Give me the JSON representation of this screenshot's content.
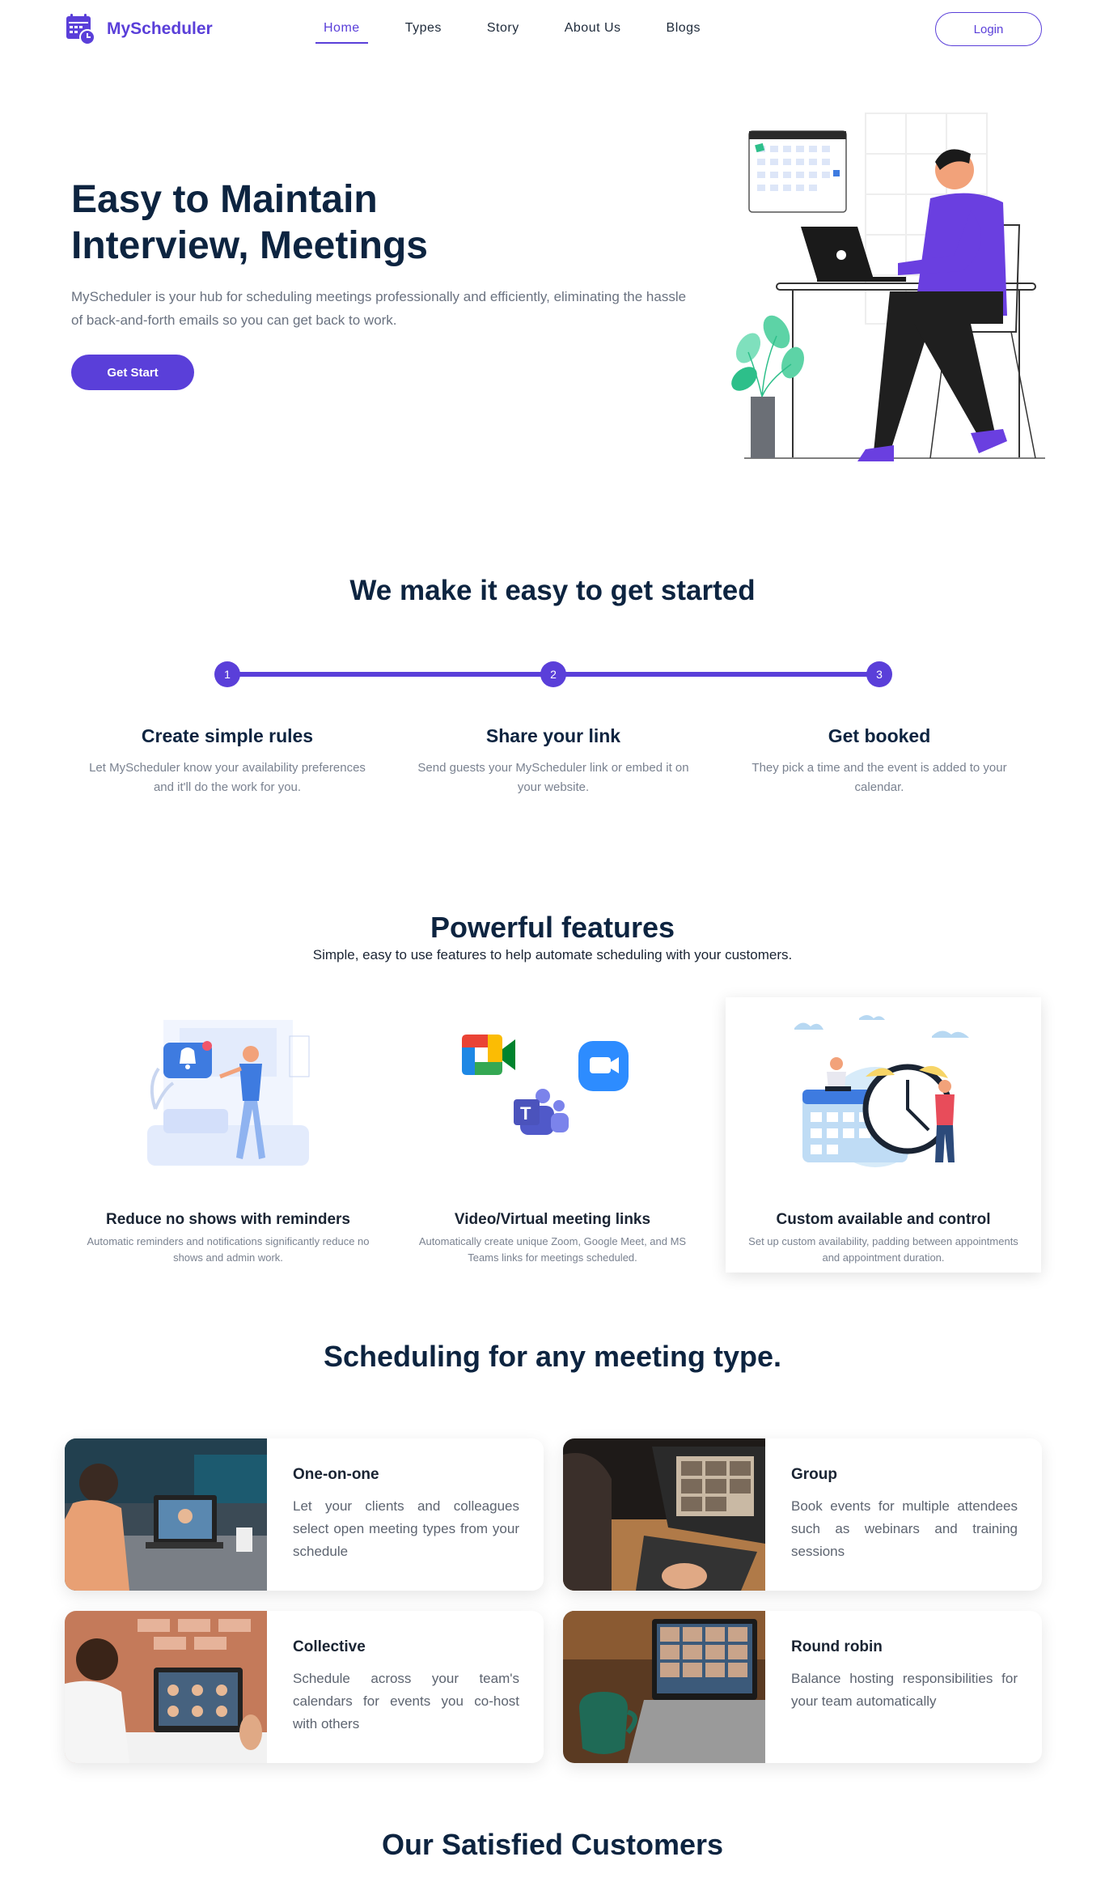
{
  "brand": {
    "name": "MyScheduler",
    "accent": "#5a3fd9",
    "logo_icon": "calendar-clock-icon"
  },
  "nav": {
    "links": [
      {
        "label": "Home",
        "active": true
      },
      {
        "label": "Types"
      },
      {
        "label": "Story"
      },
      {
        "label": "About Us"
      },
      {
        "label": "Blogs"
      }
    ],
    "login_label": "Login"
  },
  "hero": {
    "title_line1": "Easy to Maintain",
    "title_line2": "Interview, Meetings",
    "description": "MyScheduler is your hub for scheduling meetings professionally and efficiently, eliminating the hassle of back-and-forth emails so you can get back to work.",
    "cta_label": "Get Start"
  },
  "steps": {
    "title": "We make it easy to get started",
    "items": [
      {
        "number": "1",
        "title": "Create simple rules",
        "description": "Let MyScheduler know your availability preferences and it'll do the work for you."
      },
      {
        "number": "2",
        "title": "Share your link",
        "description": "Send guests your MyScheduler link or embed it on your website."
      },
      {
        "number": "3",
        "title": "Get booked",
        "description": "They pick a time and the event is added to your calendar."
      }
    ]
  },
  "features": {
    "title": "Powerful features",
    "subtitle": "Simple, easy to use features to help automate scheduling with your customers.",
    "items": [
      {
        "title": "Reduce no shows with reminders",
        "description": "Automatic reminders and notifications significantly reduce no shows and admin work.",
        "illustration": "reminder-illustration"
      },
      {
        "title": "Video/Virtual meeting links",
        "description": "Automatically create unique Zoom, Google Meet, and MS Teams links for meetings scheduled.",
        "illustration": "video-apps-illustration"
      },
      {
        "title": "Custom available and control",
        "description": "Set up custom availability, padding between appointments and appointment duration.",
        "illustration": "clock-calendar-illustration"
      }
    ]
  },
  "meeting_types": {
    "title": "Scheduling for any meeting type.",
    "items": [
      {
        "name": "One-on-one",
        "description": "Let your clients and colleagues select open meeting types from your schedule"
      },
      {
        "name": "Group",
        "description": "Book events for multiple attendees such as webinars and training sessions"
      },
      {
        "name": "Collective",
        "description": "Schedule across your team's calendars for events you co-host with others"
      },
      {
        "name": "Round robin",
        "description": "Balance hosting responsibilities for your team automatically"
      }
    ]
  },
  "customers": {
    "title": "Our Satisfied Customers"
  }
}
